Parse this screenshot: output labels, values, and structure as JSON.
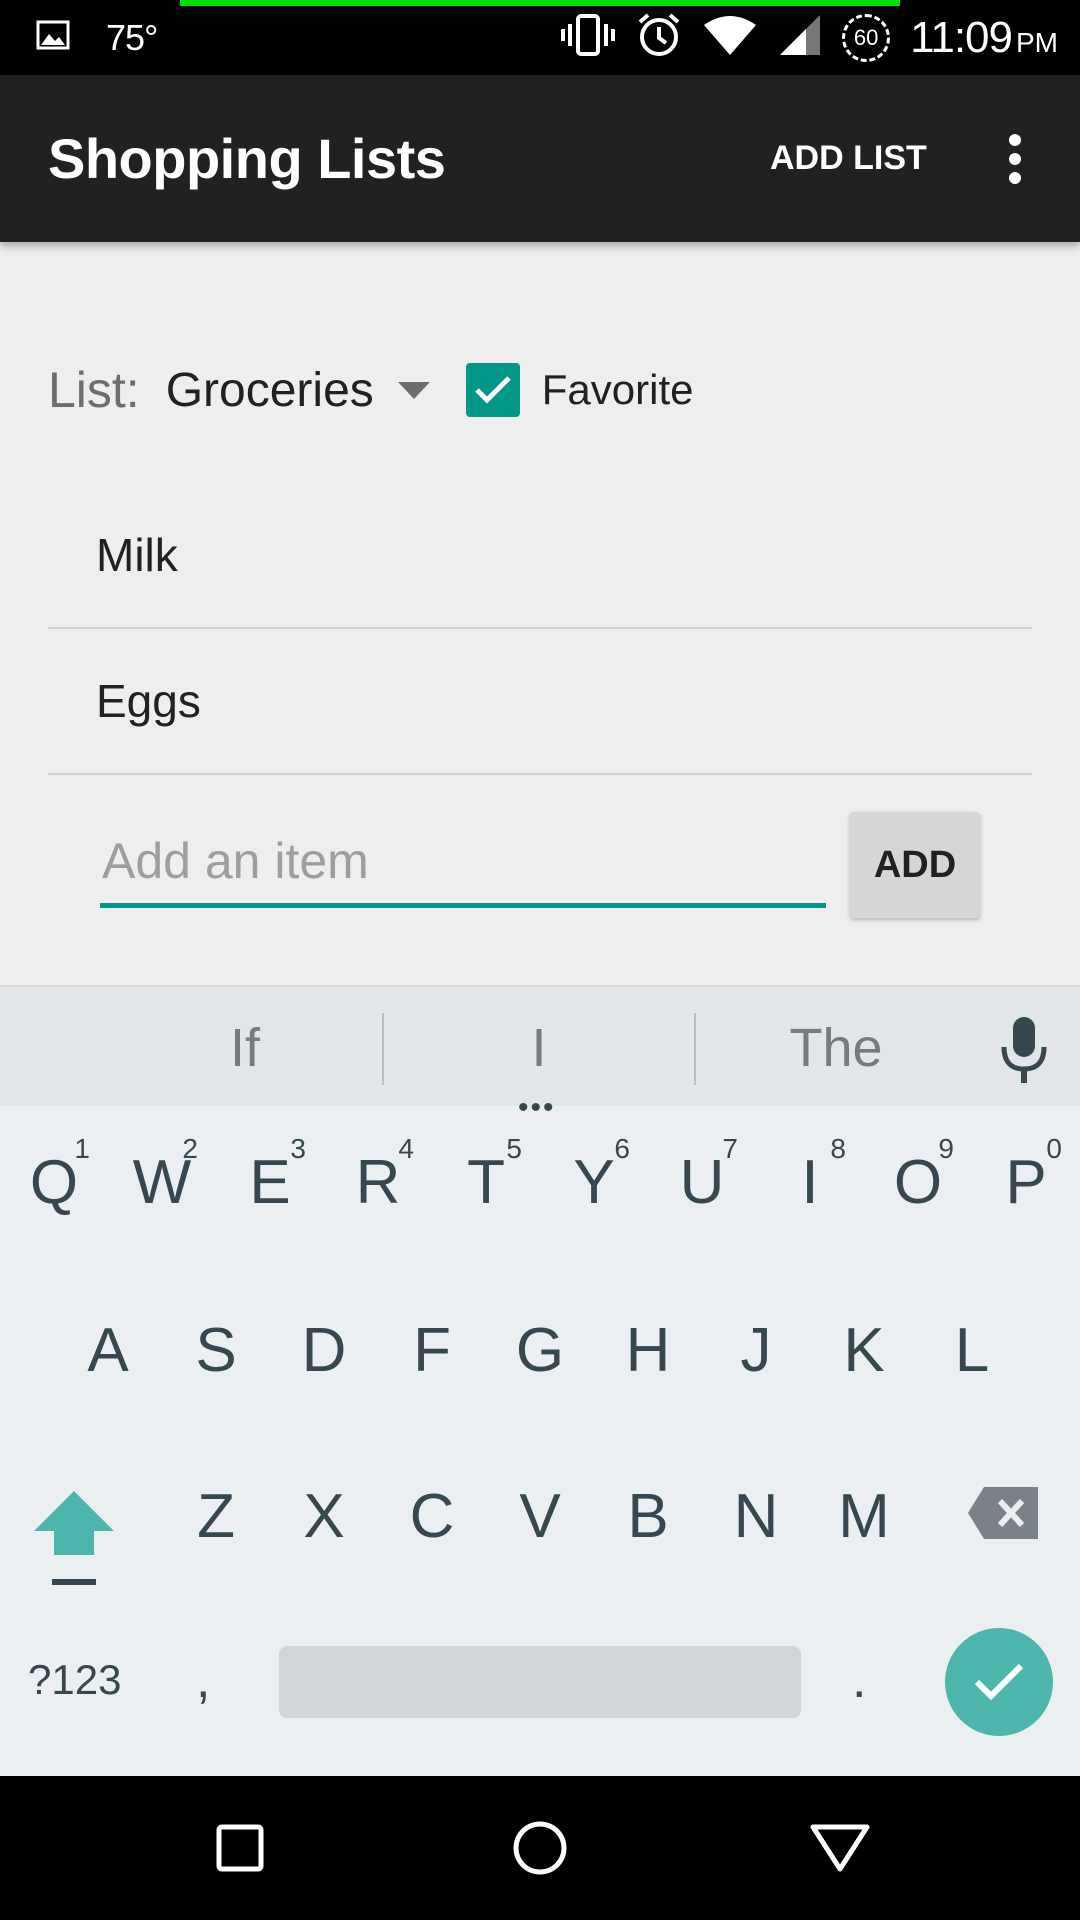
{
  "status_bar": {
    "temperature": "75°",
    "battery_level": "60",
    "time": "11:09",
    "ampm": "PM",
    "icons": [
      "gallery-icon",
      "vibrate-icon",
      "alarm-icon",
      "wifi-icon",
      "signal-icon",
      "battery-saver-icon"
    ]
  },
  "app_bar": {
    "title": "Shopping Lists",
    "add_list_label": "ADD LIST",
    "overflow_icon": "more-vert-icon"
  },
  "list_selector": {
    "label": "List:",
    "selected": "Groceries",
    "favorite_label": "Favorite",
    "favorite_checked": true
  },
  "items": [
    {
      "name": "Milk"
    },
    {
      "name": "Eggs"
    }
  ],
  "add_item": {
    "placeholder": "Add an item",
    "value": "",
    "button_label": "ADD"
  },
  "keyboard": {
    "suggestions": [
      "If",
      "I",
      "The"
    ],
    "row1": [
      {
        "key": "Q",
        "hint": "1"
      },
      {
        "key": "W",
        "hint": "2"
      },
      {
        "key": "E",
        "hint": "3"
      },
      {
        "key": "R",
        "hint": "4"
      },
      {
        "key": "T",
        "hint": "5"
      },
      {
        "key": "Y",
        "hint": "6"
      },
      {
        "key": "U",
        "hint": "7"
      },
      {
        "key": "I",
        "hint": "8"
      },
      {
        "key": "O",
        "hint": "9"
      },
      {
        "key": "P",
        "hint": "0"
      }
    ],
    "row2": [
      "A",
      "S",
      "D",
      "F",
      "G",
      "H",
      "J",
      "K",
      "L"
    ],
    "row3": [
      "Z",
      "X",
      "C",
      "V",
      "B",
      "N",
      "M"
    ],
    "symbols_label": "?123",
    "comma": ",",
    "period": ".",
    "accent_color": "#4db6ac"
  },
  "colors": {
    "app_bar": "#212121",
    "accent": "#009688"
  }
}
